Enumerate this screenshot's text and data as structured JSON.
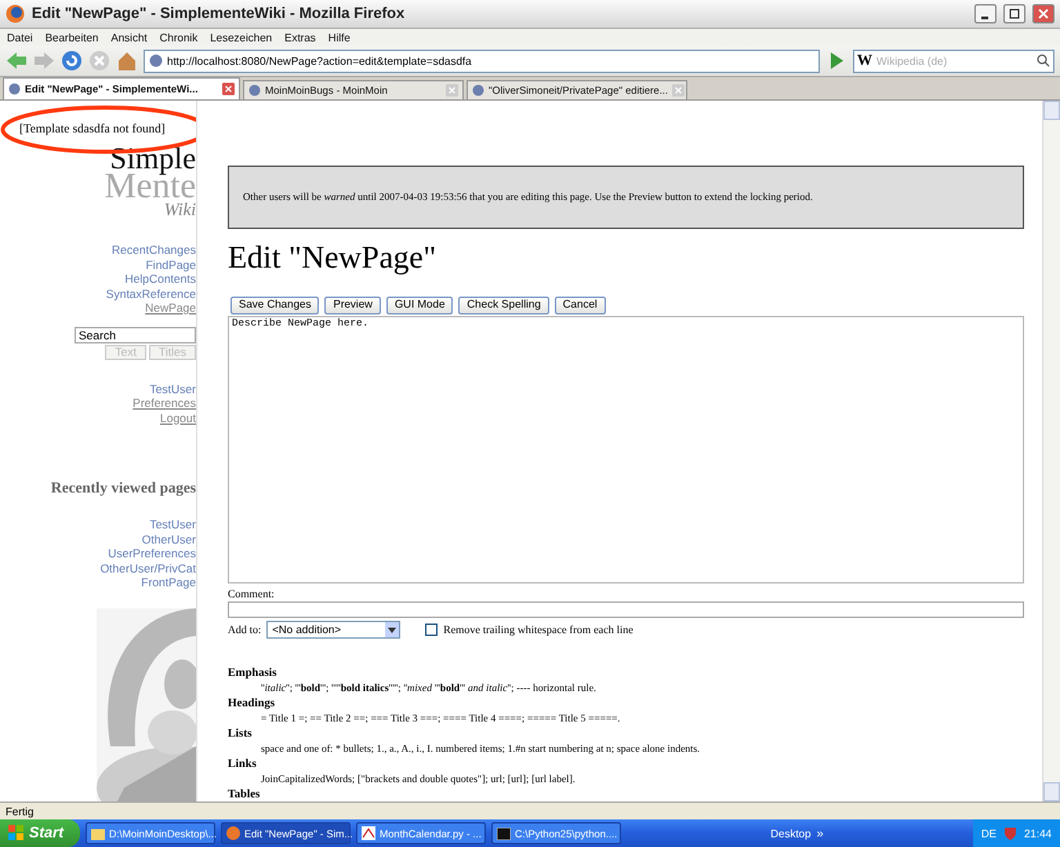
{
  "window": {
    "title": "Edit \"NewPage\" - SimplementeWiki - Mozilla Firefox"
  },
  "menu": [
    "Datei",
    "Bearbeiten",
    "Ansicht",
    "Chronik",
    "Lesezeichen",
    "Extras",
    "Hilfe"
  ],
  "address_bar": {
    "url": "http://localhost:8080/NewPage?action=edit&template=sdasdfa"
  },
  "search": {
    "engine": "W",
    "placeholder": "Wikipedia (de)"
  },
  "tabs": [
    {
      "label": "Edit \"NewPage\" - SimplementeWi...",
      "selected": true
    },
    {
      "label": "MoinMoinBugs - MoinMoin",
      "selected": false
    },
    {
      "label": "\"OliverSimoneit/PrivatePage\" editiere...",
      "selected": false
    }
  ],
  "page": {
    "template_message": "[Template sdasdfa not found]",
    "logo": {
      "line_1": "Simple",
      "line_2": "Mente",
      "line_3": "Wiki"
    },
    "nav_links": [
      {
        "label": "RecentChanges",
        "underlined": false
      },
      {
        "label": "FindPage",
        "underlined": false
      },
      {
        "label": "HelpContents",
        "underlined": false
      },
      {
        "label": "SyntaxReference",
        "underlined": false
      },
      {
        "label": "NewPage",
        "underlined": true
      }
    ],
    "sidebar_search": {
      "value": "Search",
      "buttons": [
        {
          "label": "Text",
          "disabled": true
        },
        {
          "label": "Titles",
          "disabled": true
        }
      ]
    },
    "user_links": [
      {
        "label": "TestUser",
        "underlined": false
      },
      {
        "label": "Preferences",
        "underlined": true
      },
      {
        "label": "Logout",
        "underlined": true
      }
    ],
    "recent_title": "Recently viewed pages",
    "recent_pages": [
      "TestUser",
      "OtherUser",
      "UserPreferences",
      "OtherUser/PrivCat",
      "FrontPage"
    ],
    "warning": "Other users will be *warned* until 2007-04-03 19:53:56 that you are editing this page. Use the Preview button to extend the locking period.",
    "heading": "Edit \"NewPage\"",
    "buttons": [
      "Save Changes",
      "Preview",
      "GUI Mode",
      "Check Spelling",
      "Cancel"
    ],
    "editor": {
      "value": "Describe NewPage here."
    },
    "comment": {
      "label": "Comment:"
    },
    "add_to": {
      "label": "Add to:",
      "value": "<No addition>"
    },
    "trim_whitespace": {
      "label": "Remove trailing whitespace from each line",
      "checked": false
    },
    "help": [
      {
        "title": "Emphasis",
        "text": "''*italic*''; '''**bold**'''; '''''**bold italics**'''''; ''*mixed* '''**bold**''' *and italic*''; ---- horizontal rule."
      },
      {
        "title": "Headings",
        "text": "= Title 1 =; == Title 2 ==; === Title 3 ===; ==== Title 4 ====; ===== Title 5 =====."
      },
      {
        "title": "Lists",
        "text": "space and one of: * bullets; 1., a., A., i., I. numbered items; 1.#n start numbering at n; space alone indents."
      },
      {
        "title": "Links",
        "text": "JoinCapitalizedWords; [\"brackets and double quotes\"]; url; [url]; [url label]."
      },
      {
        "title": "Tables"
      }
    ]
  },
  "status_bar": "Fertig",
  "taskbar": {
    "start": "Start",
    "tasks": [
      {
        "label": "D:\\MoinMoinDesktop\\...",
        "kind": "folder",
        "selected": false
      },
      {
        "label": "Edit \"NewPage\" - Sim...",
        "kind": "browser",
        "selected": true
      },
      {
        "label": "MonthCalendar.py - ...",
        "kind": "editor",
        "selected": false
      },
      {
        "label": "C:\\Python25\\python....",
        "kind": "console",
        "selected": false
      }
    ],
    "toolbar": "Desktop",
    "chevron": "»",
    "language": "DE",
    "clock": "21:44"
  }
}
